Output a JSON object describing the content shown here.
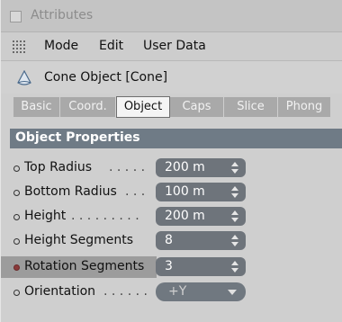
{
  "titlebar": {
    "label": "Attributes"
  },
  "menu": {
    "items": [
      "Mode",
      "Edit",
      "User Data"
    ]
  },
  "object": {
    "title": "Cone Object [Cone]"
  },
  "tabs": {
    "items": [
      "Basic",
      "Coord.",
      "Object",
      "Caps",
      "Slice",
      "Phong"
    ],
    "active": "Object"
  },
  "section": {
    "title": "Object Properties"
  },
  "properties": [
    {
      "label": "Top Radius",
      "leader": ". . . . .",
      "value": "200 m"
    },
    {
      "label": "Bottom Radius",
      "leader": ". . .",
      "value": "100 m"
    },
    {
      "label": "Height",
      "leader": ". . . . . . . . .",
      "value": "200 m"
    },
    {
      "label": "Height Segments",
      "leader": "",
      "value": "8"
    },
    {
      "label": "Rotation Segments",
      "leader": "",
      "value": "3"
    },
    {
      "label": "Orientation",
      "leader": ". . . . . .",
      "value": "+Y"
    }
  ],
  "colors": {
    "section_bg": "#6f7b86",
    "field_bg": "#6e747b",
    "tab_bg": "#a9a9a9",
    "active_dot": "#8a3a3a"
  },
  "icons": {
    "grip": "grip-icon",
    "cone": "cone-icon",
    "spinner": "spinner-arrows-icon",
    "caret": "chevron-down-icon"
  }
}
